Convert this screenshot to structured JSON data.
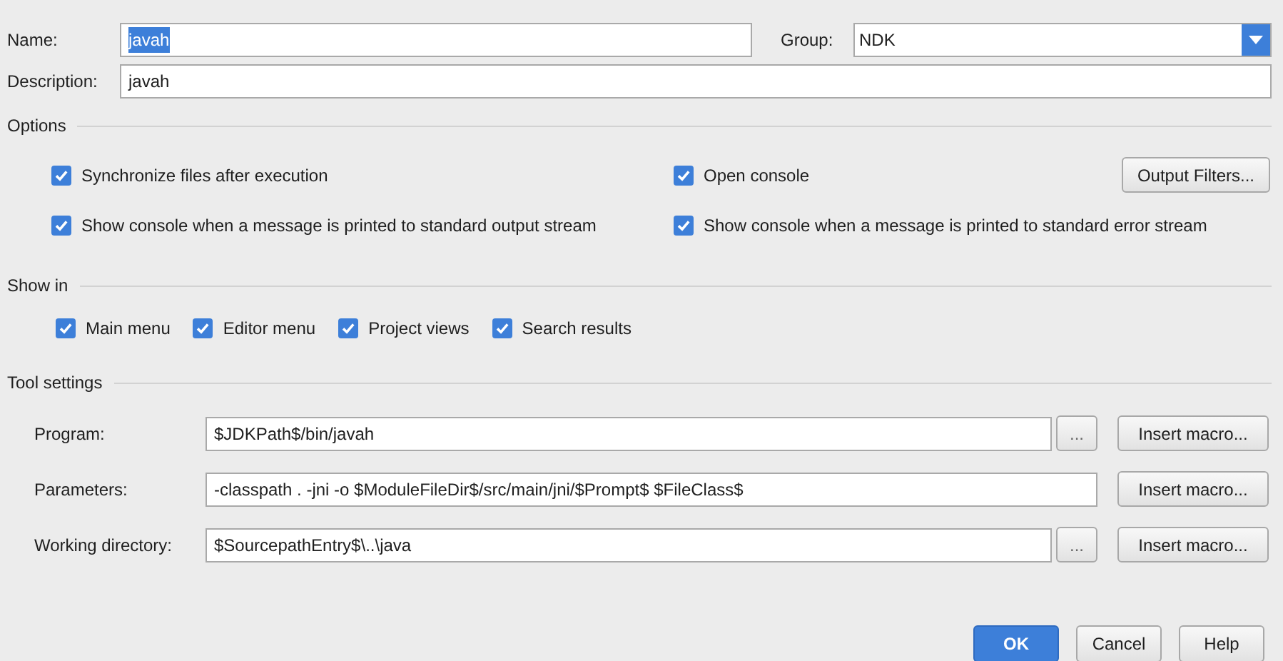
{
  "name": {
    "label": "Name:",
    "value": "javah",
    "text_selected": true
  },
  "group": {
    "label": "Group:",
    "value": "NDK"
  },
  "description": {
    "label": "Description:",
    "value": "javah"
  },
  "options": {
    "title": "Options",
    "items": [
      {
        "label": "Synchronize files after execution",
        "checked": true
      },
      {
        "label": "Open console",
        "checked": true
      },
      {
        "label": "Show console when a message is printed to standard output stream",
        "checked": true
      },
      {
        "label": "Show console when a message is printed to standard error stream",
        "checked": true
      }
    ],
    "button": "Output Filters..."
  },
  "show_in": {
    "title": "Show in",
    "items": [
      {
        "label": "Main menu",
        "checked": true
      },
      {
        "label": "Editor menu",
        "checked": true
      },
      {
        "label": "Project views",
        "checked": true
      },
      {
        "label": "Search results",
        "checked": true
      }
    ]
  },
  "tool_settings": {
    "title": "Tool settings",
    "rows": [
      {
        "label": "Program:",
        "value": "$JDKPath$/bin/javah",
        "browse": "...",
        "macro": "Insert macro..."
      },
      {
        "label": "Parameters:",
        "value": "-classpath . -jni -o $ModuleFileDir$/src/main/jni/$Prompt$ $FileClass$",
        "macro": "Insert macro..."
      },
      {
        "label": "Working directory:",
        "value": "$SourcepathEntry$\\..\\java",
        "browse": "...",
        "macro": "Insert macro..."
      }
    ]
  },
  "buttons": [
    {
      "label": "OK",
      "default": true
    },
    {
      "label": "Cancel",
      "default": false
    },
    {
      "label": "Help",
      "default": false
    }
  ]
}
